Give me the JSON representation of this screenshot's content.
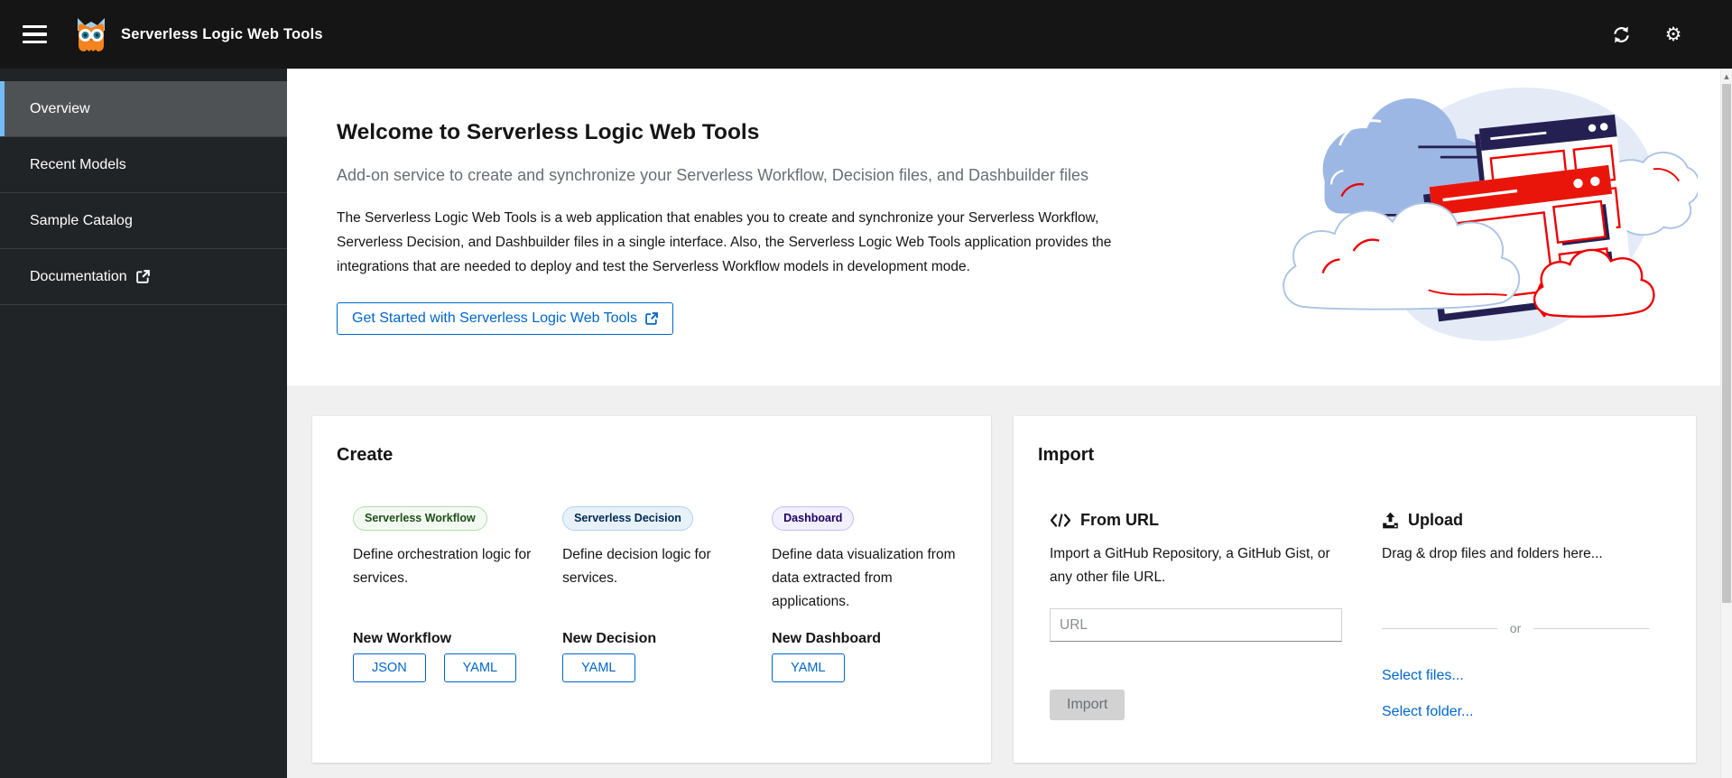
{
  "colors": {
    "accent_blue": "#0066cc",
    "masthead_bg": "#151515",
    "sidebar_bg": "#212427",
    "selected_indicator": "#73bcf7",
    "band_bg": "#f0f0f0",
    "disabled_button_bg": "#d2d2d2",
    "badge_green_text": "#1e4f18",
    "badge_blue_text": "#002952",
    "badge_purple_text": "#1f0066",
    "illustration_red": "#ee0000",
    "illustration_navy": "#252052",
    "illustration_blue": "#9db7e4"
  },
  "header": {
    "title": "Serverless Logic Web Tools",
    "icons": [
      "hamburger-menu",
      "owl-logo",
      "sync",
      "settings-gear"
    ]
  },
  "sidebar": {
    "items": [
      {
        "label": "Overview",
        "selected": true
      },
      {
        "label": "Recent Models",
        "selected": false
      },
      {
        "label": "Sample Catalog",
        "selected": false
      },
      {
        "label": "Documentation",
        "selected": false,
        "icon": "external-link"
      }
    ]
  },
  "welcome": {
    "title": "Welcome to Serverless Logic Web Tools",
    "subtitle": "Add-on service to create and synchronize your Serverless Workflow, Decision files, and Dashbuilder files",
    "description": "The Serverless Logic Web Tools is a web application that enables you to create and synchronize your Serverless Workflow, Serverless Decision, and Dashbuilder files in a single interface. Also, the Serverless Logic Web Tools application provides the integrations that are needed to deploy and test the Serverless Workflow models in development mode.",
    "cta_label": "Get Started with Serverless Logic Web Tools",
    "cta_icon": "external-link"
  },
  "create": {
    "title": "Create",
    "columns": [
      {
        "badge": "Serverless Workflow",
        "badge_color": "green",
        "description": "Define orchestration logic for services.",
        "heading": "New Workflow",
        "buttons": [
          "JSON",
          "YAML"
        ]
      },
      {
        "badge": "Serverless Decision",
        "badge_color": "blue",
        "description": "Define decision logic for services.",
        "heading": "New Decision",
        "buttons": [
          "YAML"
        ]
      },
      {
        "badge": "Dashboard",
        "badge_color": "purple",
        "description": "Define data visualization from data extracted from applications.",
        "heading": "New Dashboard",
        "buttons": [
          "YAML"
        ]
      }
    ]
  },
  "import": {
    "title": "Import",
    "from_url": {
      "heading": "From URL",
      "icon": "code",
      "description": "Import a GitHub Repository, a GitHub Gist, or any other file URL.",
      "input_placeholder": "URL",
      "input_value": "",
      "button_label": "Import",
      "button_disabled": true
    },
    "upload": {
      "heading": "Upload",
      "icon": "upload",
      "description": "Drag & drop files and folders here...",
      "divider_label": "or",
      "links": [
        "Select files...",
        "Select folder..."
      ]
    }
  }
}
